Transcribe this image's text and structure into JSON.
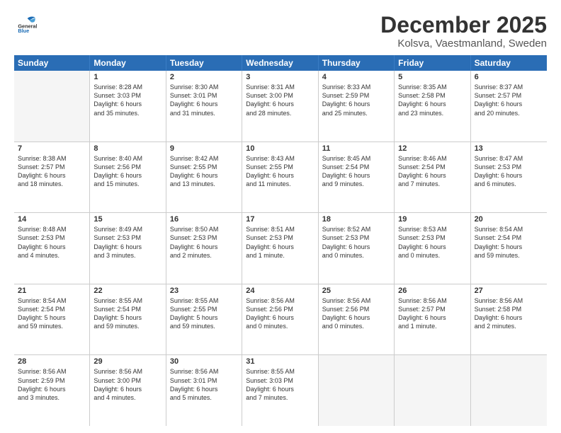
{
  "header": {
    "logo_general": "General",
    "logo_blue": "Blue",
    "main_title": "December 2025",
    "sub_title": "Kolsva, Vaestmanland, Sweden"
  },
  "weekdays": [
    "Sunday",
    "Monday",
    "Tuesday",
    "Wednesday",
    "Thursday",
    "Friday",
    "Saturday"
  ],
  "weeks": [
    [
      {
        "day": "",
        "empty": true
      },
      {
        "day": "1",
        "line1": "Sunrise: 8:28 AM",
        "line2": "Sunset: 3:03 PM",
        "line3": "Daylight: 6 hours",
        "line4": "and 35 minutes."
      },
      {
        "day": "2",
        "line1": "Sunrise: 8:30 AM",
        "line2": "Sunset: 3:01 PM",
        "line3": "Daylight: 6 hours",
        "line4": "and 31 minutes."
      },
      {
        "day": "3",
        "line1": "Sunrise: 8:31 AM",
        "line2": "Sunset: 3:00 PM",
        "line3": "Daylight: 6 hours",
        "line4": "and 28 minutes."
      },
      {
        "day": "4",
        "line1": "Sunrise: 8:33 AM",
        "line2": "Sunset: 2:59 PM",
        "line3": "Daylight: 6 hours",
        "line4": "and 25 minutes."
      },
      {
        "day": "5",
        "line1": "Sunrise: 8:35 AM",
        "line2": "Sunset: 2:58 PM",
        "line3": "Daylight: 6 hours",
        "line4": "and 23 minutes."
      },
      {
        "day": "6",
        "line1": "Sunrise: 8:37 AM",
        "line2": "Sunset: 2:57 PM",
        "line3": "Daylight: 6 hours",
        "line4": "and 20 minutes."
      }
    ],
    [
      {
        "day": "7",
        "line1": "Sunrise: 8:38 AM",
        "line2": "Sunset: 2:57 PM",
        "line3": "Daylight: 6 hours",
        "line4": "and 18 minutes."
      },
      {
        "day": "8",
        "line1": "Sunrise: 8:40 AM",
        "line2": "Sunset: 2:56 PM",
        "line3": "Daylight: 6 hours",
        "line4": "and 15 minutes."
      },
      {
        "day": "9",
        "line1": "Sunrise: 8:42 AM",
        "line2": "Sunset: 2:55 PM",
        "line3": "Daylight: 6 hours",
        "line4": "and 13 minutes."
      },
      {
        "day": "10",
        "line1": "Sunrise: 8:43 AM",
        "line2": "Sunset: 2:55 PM",
        "line3": "Daylight: 6 hours",
        "line4": "and 11 minutes."
      },
      {
        "day": "11",
        "line1": "Sunrise: 8:45 AM",
        "line2": "Sunset: 2:54 PM",
        "line3": "Daylight: 6 hours",
        "line4": "and 9 minutes."
      },
      {
        "day": "12",
        "line1": "Sunrise: 8:46 AM",
        "line2": "Sunset: 2:54 PM",
        "line3": "Daylight: 6 hours",
        "line4": "and 7 minutes."
      },
      {
        "day": "13",
        "line1": "Sunrise: 8:47 AM",
        "line2": "Sunset: 2:53 PM",
        "line3": "Daylight: 6 hours",
        "line4": "and 6 minutes."
      }
    ],
    [
      {
        "day": "14",
        "line1": "Sunrise: 8:48 AM",
        "line2": "Sunset: 2:53 PM",
        "line3": "Daylight: 6 hours",
        "line4": "and 4 minutes."
      },
      {
        "day": "15",
        "line1": "Sunrise: 8:49 AM",
        "line2": "Sunset: 2:53 PM",
        "line3": "Daylight: 6 hours",
        "line4": "and 3 minutes."
      },
      {
        "day": "16",
        "line1": "Sunrise: 8:50 AM",
        "line2": "Sunset: 2:53 PM",
        "line3": "Daylight: 6 hours",
        "line4": "and 2 minutes."
      },
      {
        "day": "17",
        "line1": "Sunrise: 8:51 AM",
        "line2": "Sunset: 2:53 PM",
        "line3": "Daylight: 6 hours",
        "line4": "and 1 minute."
      },
      {
        "day": "18",
        "line1": "Sunrise: 8:52 AM",
        "line2": "Sunset: 2:53 PM",
        "line3": "Daylight: 6 hours",
        "line4": "and 0 minutes."
      },
      {
        "day": "19",
        "line1": "Sunrise: 8:53 AM",
        "line2": "Sunset: 2:53 PM",
        "line3": "Daylight: 6 hours",
        "line4": "and 0 minutes."
      },
      {
        "day": "20",
        "line1": "Sunrise: 8:54 AM",
        "line2": "Sunset: 2:54 PM",
        "line3": "Daylight: 5 hours",
        "line4": "and 59 minutes."
      }
    ],
    [
      {
        "day": "21",
        "line1": "Sunrise: 8:54 AM",
        "line2": "Sunset: 2:54 PM",
        "line3": "Daylight: 5 hours",
        "line4": "and 59 minutes."
      },
      {
        "day": "22",
        "line1": "Sunrise: 8:55 AM",
        "line2": "Sunset: 2:54 PM",
        "line3": "Daylight: 5 hours",
        "line4": "and 59 minutes."
      },
      {
        "day": "23",
        "line1": "Sunrise: 8:55 AM",
        "line2": "Sunset: 2:55 PM",
        "line3": "Daylight: 5 hours",
        "line4": "and 59 minutes."
      },
      {
        "day": "24",
        "line1": "Sunrise: 8:56 AM",
        "line2": "Sunset: 2:56 PM",
        "line3": "Daylight: 6 hours",
        "line4": "and 0 minutes."
      },
      {
        "day": "25",
        "line1": "Sunrise: 8:56 AM",
        "line2": "Sunset: 2:56 PM",
        "line3": "Daylight: 6 hours",
        "line4": "and 0 minutes."
      },
      {
        "day": "26",
        "line1": "Sunrise: 8:56 AM",
        "line2": "Sunset: 2:57 PM",
        "line3": "Daylight: 6 hours",
        "line4": "and 1 minute."
      },
      {
        "day": "27",
        "line1": "Sunrise: 8:56 AM",
        "line2": "Sunset: 2:58 PM",
        "line3": "Daylight: 6 hours",
        "line4": "and 2 minutes."
      }
    ],
    [
      {
        "day": "28",
        "line1": "Sunrise: 8:56 AM",
        "line2": "Sunset: 2:59 PM",
        "line3": "Daylight: 6 hours",
        "line4": "and 3 minutes."
      },
      {
        "day": "29",
        "line1": "Sunrise: 8:56 AM",
        "line2": "Sunset: 3:00 PM",
        "line3": "Daylight: 6 hours",
        "line4": "and 4 minutes."
      },
      {
        "day": "30",
        "line1": "Sunrise: 8:56 AM",
        "line2": "Sunset: 3:01 PM",
        "line3": "Daylight: 6 hours",
        "line4": "and 5 minutes."
      },
      {
        "day": "31",
        "line1": "Sunrise: 8:55 AM",
        "line2": "Sunset: 3:03 PM",
        "line3": "Daylight: 6 hours",
        "line4": "and 7 minutes."
      },
      {
        "day": "",
        "empty": true
      },
      {
        "day": "",
        "empty": true
      },
      {
        "day": "",
        "empty": true
      }
    ]
  ]
}
